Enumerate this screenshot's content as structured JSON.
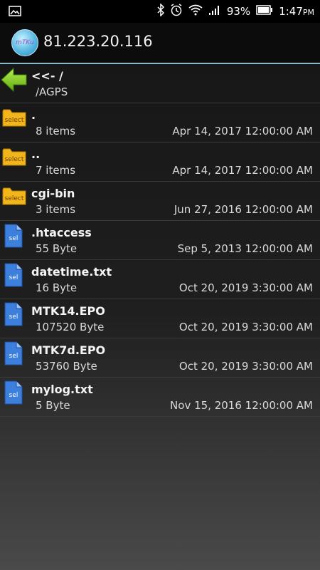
{
  "status_bar": {
    "battery": "93%",
    "time": "1:47",
    "ampm": "PM"
  },
  "app_bar": {
    "logo_text": "mTKu",
    "title": "81.223.20.116"
  },
  "parent": {
    "name": "<<- /",
    "path": "/AGPS",
    "icon": "back-arrow-icon"
  },
  "items": [
    {
      "name": ".",
      "detail": "8 items",
      "date": "Apr 14, 2017 12:00:00 AM",
      "icon": "folder-icon",
      "badge": "select"
    },
    {
      "name": "..",
      "detail": "7 items",
      "date": "Apr 14, 2017 12:00:00 AM",
      "icon": "folder-icon",
      "badge": "select"
    },
    {
      "name": "cgi-bin",
      "detail": "3 items",
      "date": "Jun 27, 2016 12:00:00 AM",
      "icon": "folder-icon",
      "badge": "select"
    },
    {
      "name": ".htaccess",
      "detail": "55 Byte",
      "date": "Sep 5, 2013 12:00:00 AM",
      "icon": "file-icon",
      "badge": "sel"
    },
    {
      "name": "datetime.txt",
      "detail": "16 Byte",
      "date": "Oct 20, 2019 3:30:00 AM",
      "icon": "file-icon",
      "badge": "sel"
    },
    {
      "name": "MTK14.EPO",
      "detail": "107520 Byte",
      "date": "Oct 20, 2019 3:30:00 AM",
      "icon": "file-icon",
      "badge": "sel"
    },
    {
      "name": "MTK7d.EPO",
      "detail": "53760 Byte",
      "date": "Oct 20, 2019 3:30:00 AM",
      "icon": "file-icon",
      "badge": "sel"
    },
    {
      "name": "mylog.txt",
      "detail": "5 Byte",
      "date": "Nov 15, 2016 12:00:00 AM",
      "icon": "file-icon",
      "badge": "sel"
    }
  ],
  "colors": {
    "accent_line": "#8fb6cf",
    "folder": "#f2b61c",
    "file": "#3d7fdc",
    "back_arrow": "#7cc81f"
  }
}
